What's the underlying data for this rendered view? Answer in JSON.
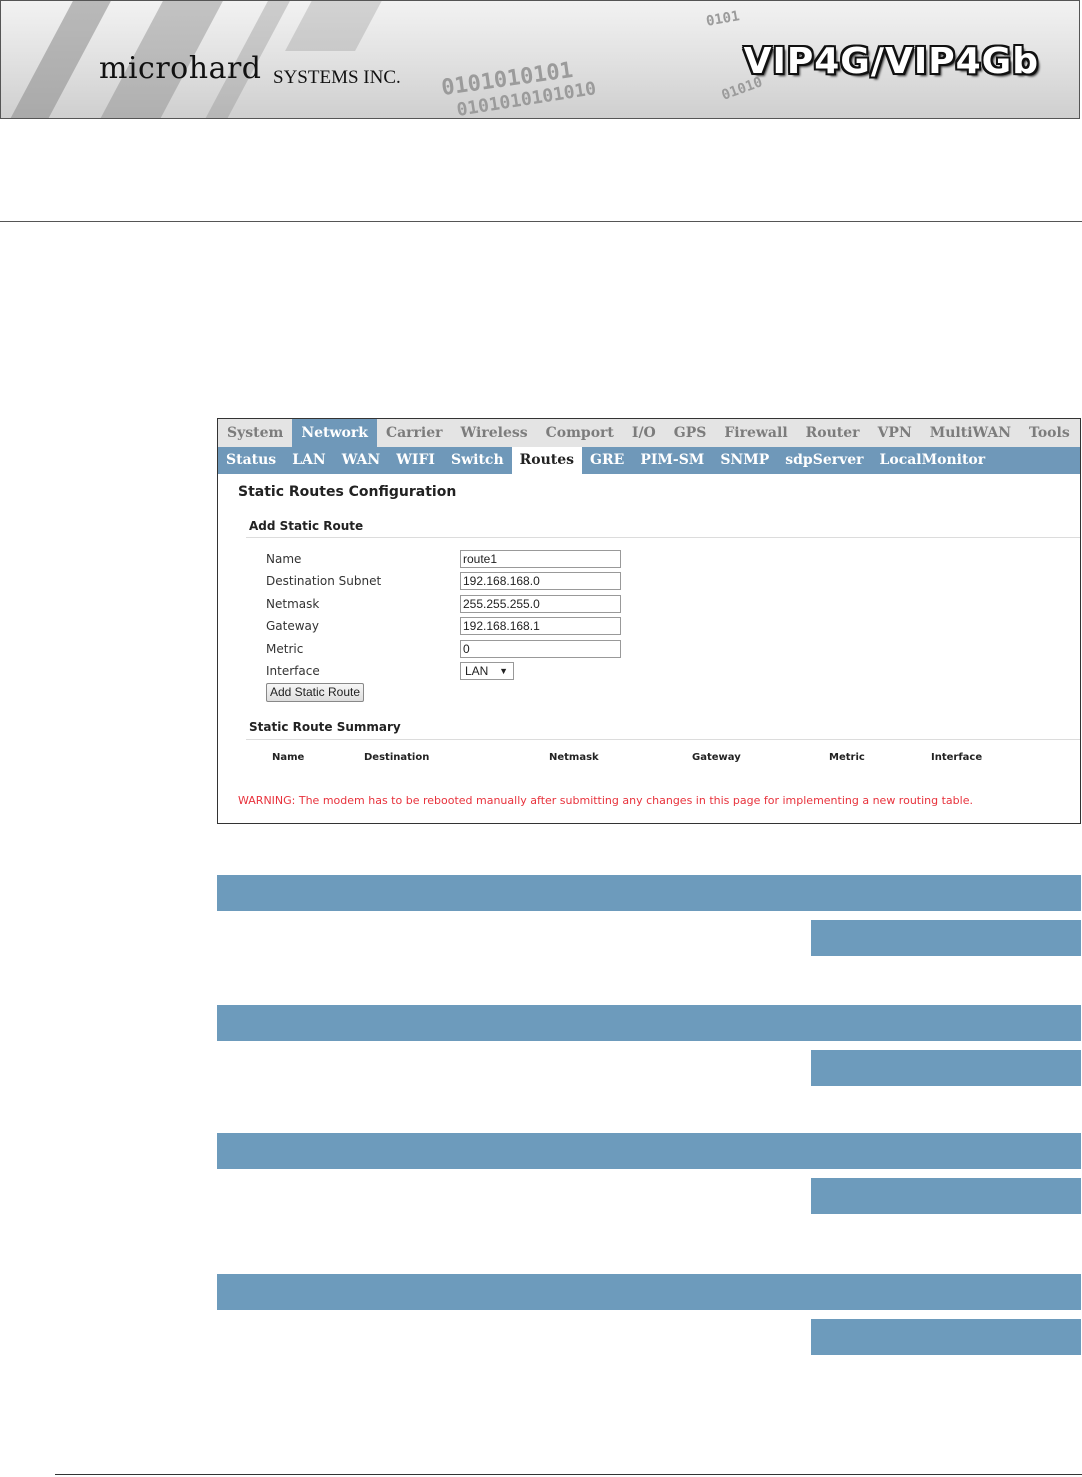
{
  "banner": {
    "brand_name": "microhard",
    "brand_sub": "SYSTEMS INC.",
    "product_title": "VIP4G/VIP4Gb",
    "binary_art": [
      "0101010101",
      "0101010101010",
      "0101010101010",
      "0101",
      "01010",
      "010"
    ]
  },
  "ui": {
    "main_tabs": [
      "System",
      "Network",
      "Carrier",
      "Wireless",
      "Comport",
      "I/O",
      "GPS",
      "Firewall",
      "Router",
      "VPN",
      "MultiWAN",
      "Tools"
    ],
    "active_main_tab": "Network",
    "sub_tabs": [
      "Status",
      "LAN",
      "WAN",
      "WIFI",
      "Switch",
      "Routes",
      "GRE",
      "PIM-SM",
      "SNMP",
      "sdpServer",
      "LocalMonitor"
    ],
    "active_sub_tab": "Routes",
    "page_heading": "Static Routes Configuration",
    "add_section_heading": "Add Static Route",
    "form": {
      "name_label": "Name",
      "name_value": "route1",
      "dest_label": "Destination Subnet",
      "dest_value": "192.168.168.0",
      "netmask_label": "Netmask",
      "netmask_value": "255.255.255.0",
      "gateway_label": "Gateway",
      "gateway_value": "192.168.168.1",
      "metric_label": "Metric",
      "metric_value": "0",
      "interface_label": "Interface",
      "interface_value": "LAN"
    },
    "add_button_label": "Add Static Route",
    "summary_heading": "Static Route Summary",
    "summary_columns": [
      "Name",
      "Destination",
      "Netmask",
      "Gateway",
      "Metric",
      "Interface"
    ],
    "warning": "WARNING: The modem has to be rebooted manually after submitting any changes in this page for implementing a new routing table."
  },
  "colors": {
    "tab_active_bg": "#6f98b9",
    "bar_blue": "#6d9bbc",
    "warning_red": "#e8323c"
  }
}
